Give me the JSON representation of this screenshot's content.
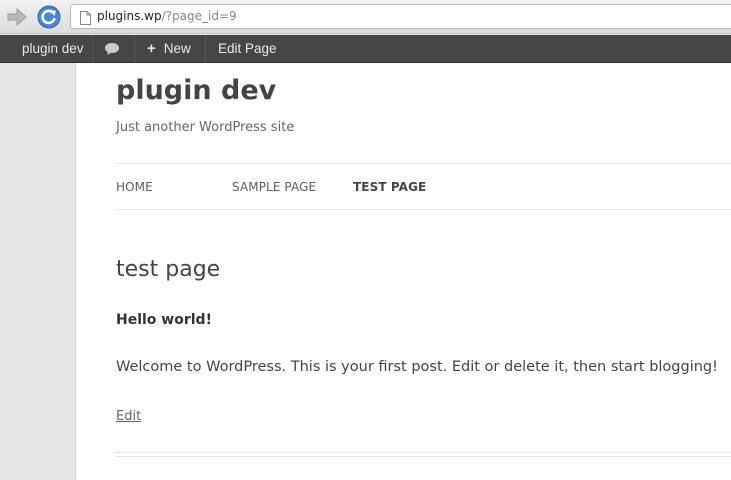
{
  "browser": {
    "url_host": "plugins.wp",
    "url_path": "/?page_id=9"
  },
  "admin_bar": {
    "site_name": "plugin dev",
    "new_label": "New",
    "edit_label": "Edit Page"
  },
  "site": {
    "title": "plugin dev",
    "description": "Just another WordPress site"
  },
  "nav": {
    "items": [
      {
        "label": "HOME"
      },
      {
        "label": "SAMPLE PAGE"
      },
      {
        "label": "TEST PAGE"
      }
    ]
  },
  "entry": {
    "title": "test page",
    "strong_text": "Hello world!",
    "body": "Welcome to WordPress. This is your first post. Edit or delete it, then start blogging!",
    "edit_link": "Edit"
  }
}
